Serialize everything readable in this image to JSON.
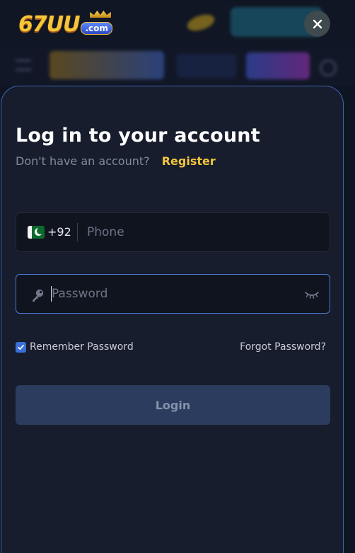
{
  "brand": {
    "logo_text": "67UU",
    "logo_suffix": ".com"
  },
  "modal": {
    "title": "Log in to your account",
    "subtitle": "Don't have an account?",
    "register_label": "Register"
  },
  "phone": {
    "country_code": "+92",
    "placeholder": "Phone",
    "value": ""
  },
  "password": {
    "placeholder": "Password",
    "value": ""
  },
  "options": {
    "remember_label": "Remember Password",
    "remember_checked": true,
    "forgot_label": "Forgot Password?"
  },
  "actions": {
    "login_label": "Login"
  },
  "icons": {
    "close": "close-icon",
    "flag": "pakistan-flag-icon",
    "key": "key-icon",
    "eye": "eye-hidden-icon",
    "check": "check-icon"
  },
  "colors": {
    "accent_yellow": "#f2c53d",
    "accent_blue": "#4d78d2",
    "modal_bg": "#171d2c",
    "button_disabled": "#2b3c5e"
  }
}
